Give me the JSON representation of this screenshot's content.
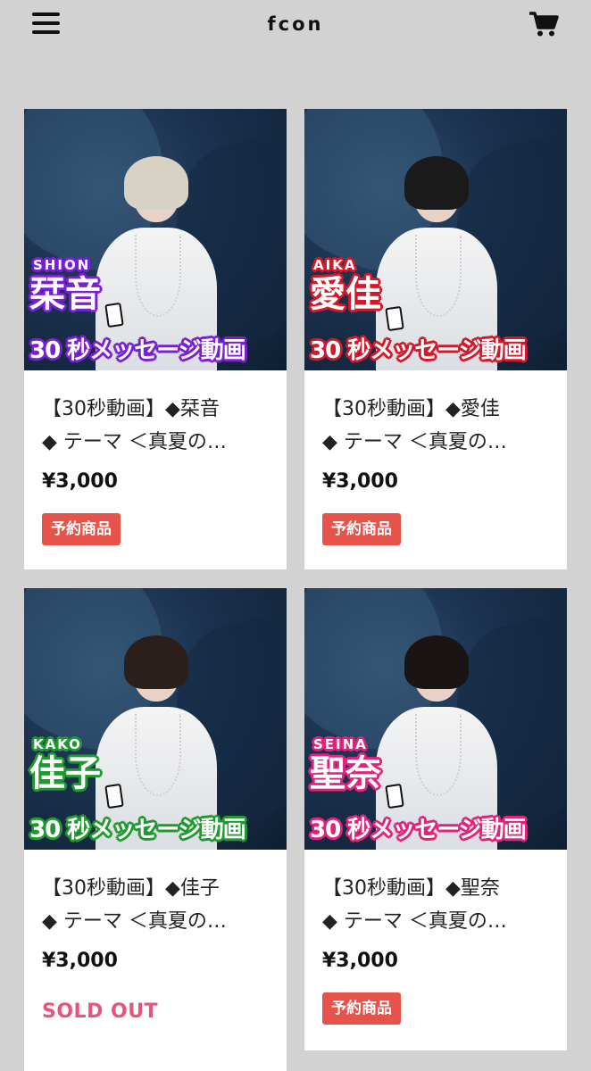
{
  "header": {
    "site_title": "fcon",
    "menu_icon": "hamburger-icon",
    "cart_icon": "cart-icon"
  },
  "products": [
    {
      "roman": "SHION",
      "kanji": "栞音",
      "banner": "30 秒メッセージ動画",
      "accent": "#7a1fd6",
      "title_line1": "【30秒動画】◆栞音",
      "title_line2": "◆ テーマ ＜真夏の…",
      "price": "¥3,000",
      "status": "予約商品",
      "hair": "#d8d2c4"
    },
    {
      "roman": "AIKA",
      "kanji": "愛佳",
      "banner": "30 秒メッセージ動画",
      "accent": "#d3182a",
      "title_line1": "【30秒動画】◆愛佳",
      "title_line2": "◆ テーマ ＜真夏の…",
      "price": "¥3,000",
      "status": "予約商品",
      "hair": "#1a1a1a"
    },
    {
      "roman": "KAKO",
      "kanji": "佳子",
      "banner": "30 秒メッセージ動画",
      "accent": "#1f9a2f",
      "title_line1": "【30秒動画】◆佳子",
      "title_line2": "◆ テーマ ＜真夏の…",
      "price": "¥3,000",
      "status": "SOLD OUT",
      "hair": "#2a1f1a"
    },
    {
      "roman": "SEINA",
      "kanji": "聖奈",
      "banner": "30 秒メッセージ動画",
      "accent": "#e0237d",
      "title_line1": "【30秒動画】◆聖奈",
      "title_line2": "◆ テーマ ＜真夏の…",
      "price": "¥3,000",
      "status": "予約商品",
      "hair": "#1a1414"
    }
  ],
  "colors": {
    "background": "#d2d2d2",
    "badge": "#e5534b",
    "sold_out": "#e8557a"
  }
}
